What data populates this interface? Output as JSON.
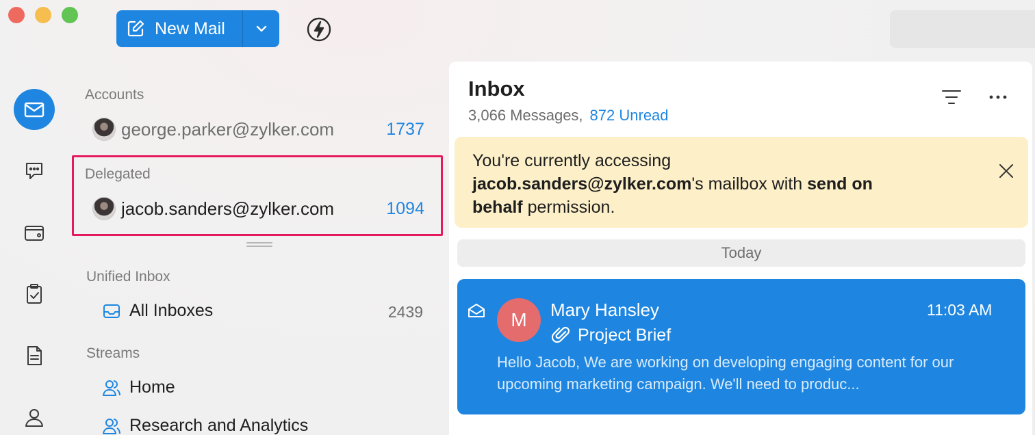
{
  "toolbar": {
    "new_mail_label": "New Mail",
    "accent": "#1e86e0"
  },
  "rail": {
    "items": [
      "mail-icon",
      "chat-icon",
      "wallet-icon",
      "tasks-icon",
      "notes-icon",
      "contacts-icon"
    ]
  },
  "folders": {
    "accounts_label": "Accounts",
    "account_email": "george.parker@zylker.com",
    "account_count": "1737",
    "delegated_label": "Delegated",
    "delegated_email": "jacob.sanders@zylker.com",
    "delegated_count": "1094",
    "unified_label": "Unified Inbox",
    "all_inboxes_label": "All Inboxes",
    "all_inboxes_count": "2439",
    "streams_label": "Streams",
    "streams": [
      "Home",
      "Research and Analytics"
    ],
    "highlight_color": "#e5195d"
  },
  "inbox": {
    "title": "Inbox",
    "messages": "3,066 Messages,",
    "unread": "872 Unread",
    "notice": {
      "line1": "You're currently accessing",
      "email": "jacob.sanders@zylker.com",
      "mid": "'s mailbox with ",
      "bold1": "send on",
      "bold2": "behalf",
      "end": " permission."
    },
    "group_label": "Today",
    "mail": {
      "avatar_letter": "M",
      "sender": "Mary Hansley",
      "time": "11:03 AM",
      "subject": "Project Brief",
      "preview": "Hello Jacob, We are working on developing engaging content for our upcoming marketing campaign. We'll need to produc..."
    }
  }
}
